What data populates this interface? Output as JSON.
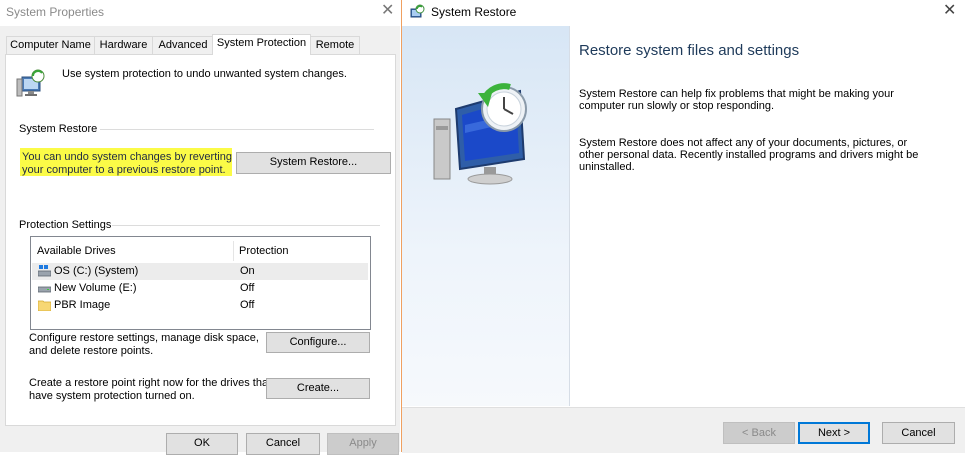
{
  "system_properties": {
    "title": "System Properties",
    "close_glyph": "✕",
    "tabs": [
      {
        "label": "Computer Name"
      },
      {
        "label": "Hardware"
      },
      {
        "label": "Advanced"
      },
      {
        "label": "System Protection"
      },
      {
        "label": "Remote"
      }
    ],
    "active_tab": "System Protection",
    "intro_text": "Use system protection to undo unwanted system changes.",
    "system_restore": {
      "group_label": "System Restore",
      "description_line1": "You can undo system changes by reverting",
      "description_line2": "your computer to a previous restore point.",
      "button_label": "System Restore..."
    },
    "protection_settings": {
      "group_label": "Protection Settings",
      "columns": [
        "Available Drives",
        "Protection"
      ],
      "drives": [
        {
          "name": "OS (C:) (System)",
          "protection": "On",
          "icon": "system-drive-icon",
          "selected": true
        },
        {
          "name": "New Volume (E:)",
          "protection": "Off",
          "icon": "drive-icon",
          "selected": false
        },
        {
          "name": "PBR Image",
          "protection": "Off",
          "icon": "folder-icon",
          "selected": false
        }
      ],
      "configure_text_line1": "Configure restore settings, manage disk space,",
      "configure_text_line2": "and delete restore points.",
      "configure_label": "Configure...",
      "create_text_line1": "Create a restore point right now for the drives that",
      "create_text_line2": "have system protection turned on.",
      "create_label": "Create..."
    },
    "footer": {
      "ok": "OK",
      "cancel": "Cancel",
      "apply": "Apply"
    },
    "highlight_color": "#fbfb47"
  },
  "system_restore_wizard": {
    "title": "System Restore",
    "close_glyph": "✕",
    "heading": "Restore system files and settings",
    "para1_line1": "System Restore can help fix problems that might be making your",
    "para1_line2": "computer run slowly or stop responding.",
    "para2_line1": "System Restore does not affect any of your documents, pictures, or",
    "para2_line2": "other personal data. Recently installed programs and drivers might be",
    "para2_line3": "uninstalled.",
    "buttons": {
      "back": "< Back",
      "next": "Next >",
      "cancel": "Cancel"
    },
    "accent_color": "#0078d7"
  }
}
